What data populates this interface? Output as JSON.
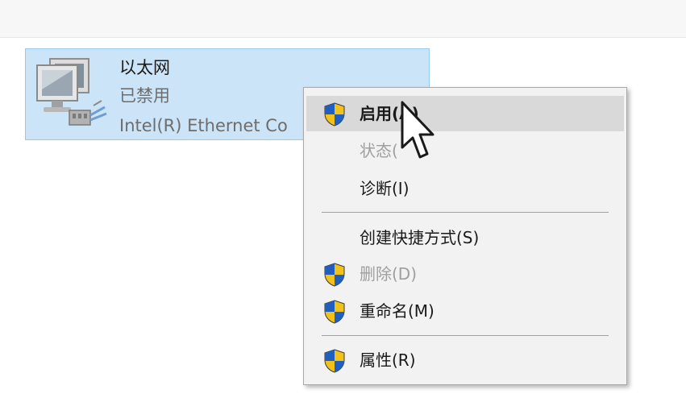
{
  "network_item": {
    "name": "以太网",
    "status": "已禁用",
    "device": "Intel(R) Ethernet Co"
  },
  "context_menu": {
    "items": [
      {
        "label": "启用(A)",
        "shield": true,
        "state": "hover",
        "bold": true
      },
      {
        "label": "状态(",
        "shield": false,
        "state": "disabled"
      },
      {
        "label": "诊断(I)",
        "shield": false,
        "state": "normal"
      },
      {
        "label": "创建快捷方式(S)",
        "shield": false,
        "state": "normal"
      },
      {
        "label": "删除(D)",
        "shield": true,
        "state": "disabled"
      },
      {
        "label": "重命名(M)",
        "shield": true,
        "state": "normal"
      },
      {
        "label": "属性(R)",
        "shield": true,
        "state": "normal"
      }
    ]
  },
  "colors": {
    "selection_bg": "#cce4f7",
    "selection_border": "#99c9ef",
    "menu_bg": "#f2f2f2",
    "menu_hover": "#d9d9d9",
    "disabled_text": "#9f9f9f",
    "shield_blue": "#1f5fbf",
    "shield_yellow": "#f2c21b"
  },
  "icons": {
    "network_adapter": "network-adapter-icon",
    "shield": "uac-shield-icon",
    "cursor": "mouse-pointer-icon"
  }
}
